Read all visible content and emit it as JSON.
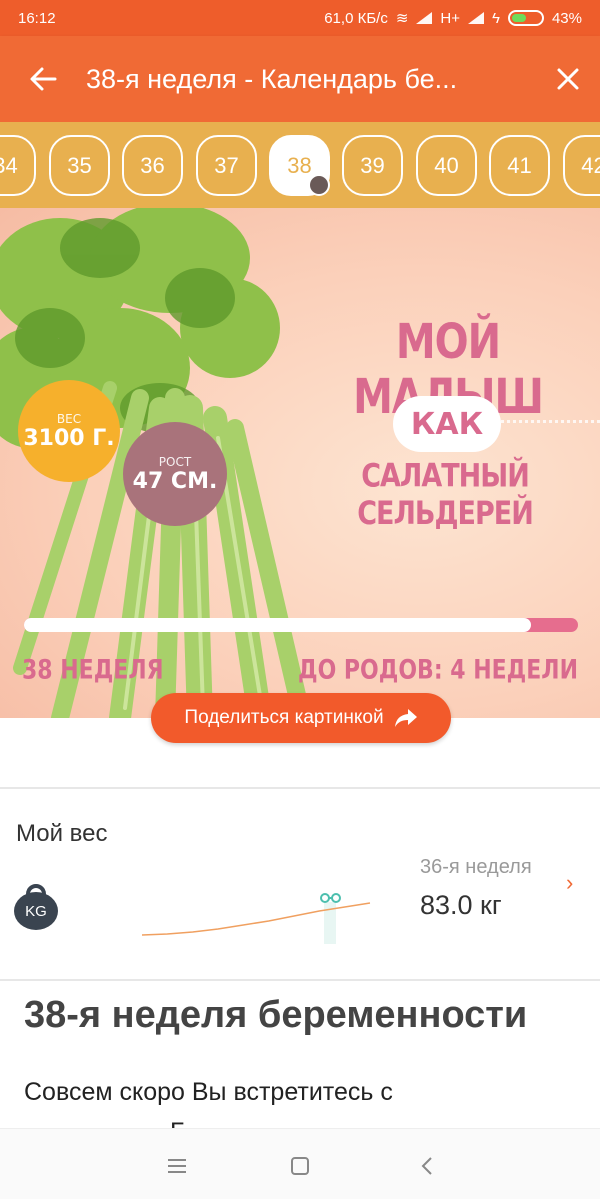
{
  "status_bar": {
    "time": "16:12",
    "net_speed": "61,0 КБ/с",
    "network": "H+",
    "battery": "43%"
  },
  "app_bar": {
    "back_icon": "arrow-left-icon",
    "title": "38-я неделя - Календарь бе...",
    "close_icon": "close-icon"
  },
  "week_strip": {
    "weeks": [
      "34",
      "35",
      "36",
      "37",
      "38",
      "39",
      "40",
      "41",
      "42"
    ],
    "selected": "38"
  },
  "hero": {
    "headline": "МОЙ МАЛЫШ",
    "connector": "КАК",
    "comparison": "САЛАТНЫЙ СЕЛЬДЕРЕЙ",
    "weight_label": "ВЕС",
    "weight_value": "3100 Г.",
    "height_label": "РОСТ",
    "height_value": "47 СМ.",
    "progress_fraction": 0.915,
    "week_text": "38 НЕДЕЛЯ",
    "remaining_text": "ДО РОДОВ: 4 НЕДЕЛИ"
  },
  "share_button": {
    "label": "Поделиться картинкой",
    "icon": "share-arrow-icon"
  },
  "weight_card": {
    "title": "Мой вес",
    "icon_text": "KG",
    "week": "36-я неделя",
    "value": "83.0 кг",
    "trend": [
      0.1,
      0.12,
      0.16,
      0.22,
      0.3,
      0.38,
      0.48,
      0.58,
      0.66,
      0.74
    ]
  },
  "article": {
    "title": "38-я неделя беременности",
    "text_line1": "Совсем скоро Вы встретитесь с",
    "text_line2": "Б"
  },
  "colors": {
    "status_bar": "#ee5d2b",
    "app_bar": "#f06a35",
    "week_strip": "#e8b04f",
    "hero_pink": "#d96a8e",
    "weight_badge": "#f6b02c",
    "height_badge": "#a9737b"
  }
}
